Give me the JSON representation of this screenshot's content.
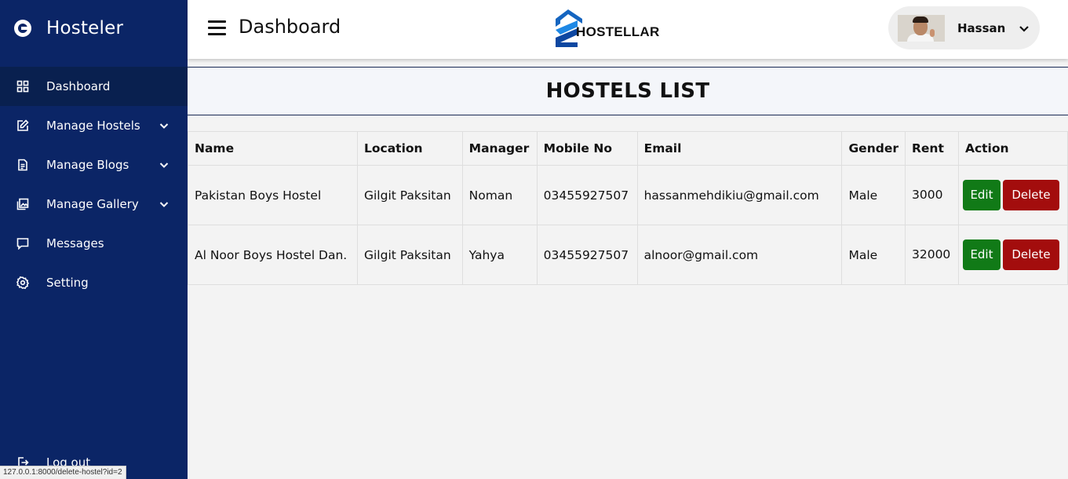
{
  "brand": {
    "name": "Hosteler"
  },
  "sidebar": {
    "items": [
      {
        "label": "Dashboard",
        "icon": "grid-icon",
        "active": true,
        "expandable": false
      },
      {
        "label": "Manage Hostels",
        "icon": "edit-icon",
        "active": false,
        "expandable": true
      },
      {
        "label": "Manage Blogs",
        "icon": "document-icon",
        "active": false,
        "expandable": true
      },
      {
        "label": "Manage Gallery",
        "icon": "gallery-icon",
        "active": false,
        "expandable": true
      },
      {
        "label": "Messages",
        "icon": "message-icon",
        "active": false,
        "expandable": false
      },
      {
        "label": "Setting",
        "icon": "gear-icon",
        "active": false,
        "expandable": false
      }
    ],
    "logout_label": "Log out"
  },
  "header": {
    "title": "Dashboard",
    "logo_text": "HOSTELLAR",
    "user_name": "Hassan"
  },
  "page": {
    "heading": "HOSTELS LIST"
  },
  "table": {
    "columns": [
      "Name",
      "Location",
      "Manager",
      "Mobile No",
      "Email",
      "Gender",
      "Rent",
      "Action"
    ],
    "rows": [
      {
        "name": "Pakistan Boys Hostel",
        "location": "Gilgit Paksitan",
        "manager": "Noman",
        "mobile": "03455927507",
        "email": "hassanmehdikiu@gmail.com",
        "gender": "Male",
        "rent": "3000",
        "edit_label": "Edit",
        "delete_label": "Delete"
      },
      {
        "name": "Al Noor Boys Hostel Dan.",
        "location": "Gilgit Paksitan",
        "manager": "Yahya",
        "mobile": "03455927507",
        "email": "alnoor@gmail.com",
        "gender": "Male",
        "rent": "32000",
        "edit_label": "Edit",
        "delete_label": "Delete"
      }
    ]
  },
  "status_bar": {
    "url": "127.0.0.1:8000/delete-hostel?id=2"
  },
  "colors": {
    "sidebar_bg": "#0b2566",
    "sidebar_active": "#09204f",
    "edit_button": "#117a17",
    "delete_button": "#a30d0d"
  }
}
